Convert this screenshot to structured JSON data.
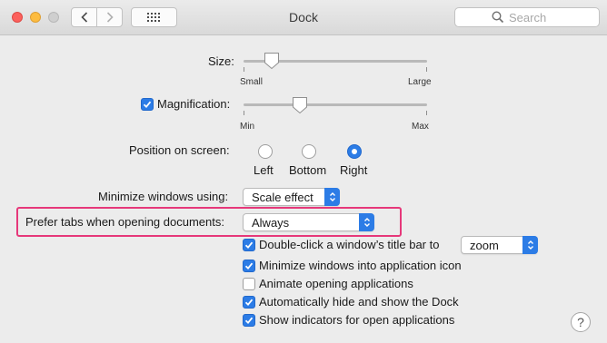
{
  "window": {
    "title": "Dock"
  },
  "toolbar": {
    "search_placeholder": "Search"
  },
  "size": {
    "label": "Size:",
    "min_label": "Small",
    "max_label": "Large",
    "value_fraction": 0.16
  },
  "magnification": {
    "label": "Magnification:",
    "checked": true,
    "min_label": "Min",
    "max_label": "Max",
    "value_fraction": 0.3
  },
  "position": {
    "label": "Position on screen:",
    "options": [
      "Left",
      "Bottom",
      "Right"
    ],
    "selected": "Right"
  },
  "minimize": {
    "label": "Minimize windows using:",
    "value": "Scale effect"
  },
  "prefer_tabs": {
    "label": "Prefer tabs when opening documents:",
    "value": "Always"
  },
  "checkboxes": [
    {
      "label": "Double-click a window’s title bar to",
      "checked": true,
      "popup_value": "zoom"
    },
    {
      "label": "Minimize windows into application icon",
      "checked": true
    },
    {
      "label": "Animate opening applications",
      "checked": false
    },
    {
      "label": "Automatically hide and show the Dock",
      "checked": true
    },
    {
      "label": "Show indicators for open applications",
      "checked": true
    }
  ],
  "help": {
    "label": "?"
  },
  "colors": {
    "accent": "#2c7ce6",
    "highlight": "#e6387a"
  }
}
